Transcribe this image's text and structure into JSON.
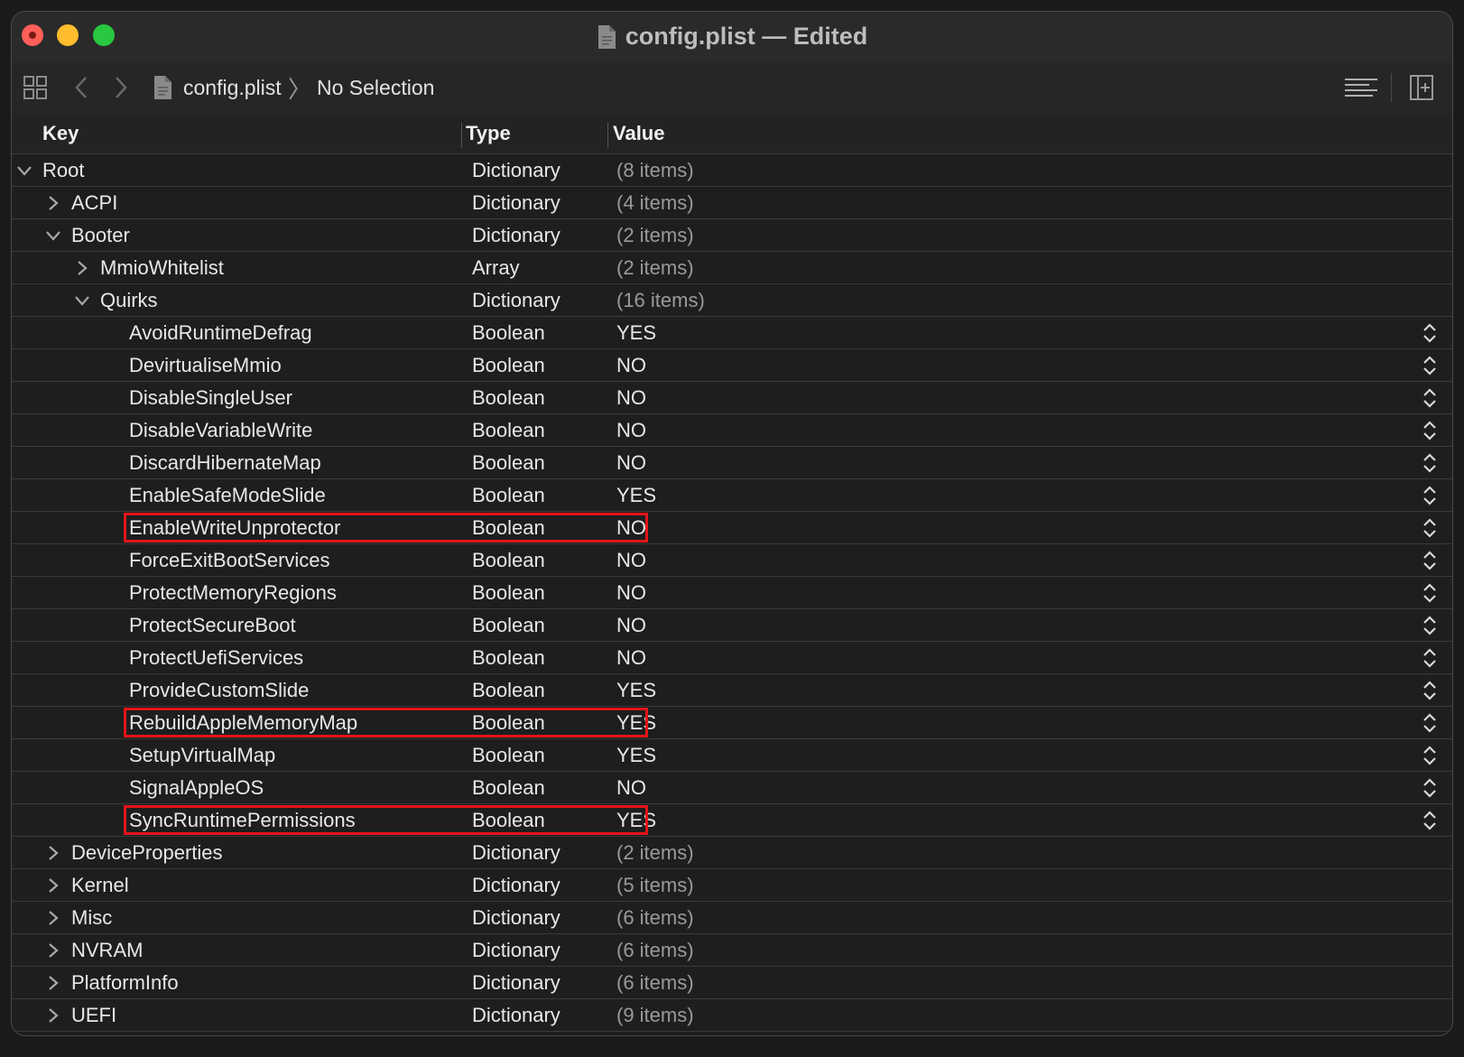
{
  "window": {
    "title": "config.plist — Edited"
  },
  "toolbar": {
    "grid_icon": "grid-icon",
    "back_icon": "chevron-left-icon",
    "forward_icon": "chevron-right-icon",
    "file_name": "config.plist",
    "separator": "〉",
    "selection": "No Selection",
    "editor_options_icon": "lines-icon",
    "add_editor_icon": "add-editor-icon"
  },
  "table": {
    "headers": {
      "key": "Key",
      "type": "Type",
      "value": "Value"
    },
    "rows": [
      {
        "key": "Root",
        "type": "Dictionary",
        "value": "(8 items)",
        "level": 0,
        "disclosure": "open",
        "kind": "container"
      },
      {
        "key": "ACPI",
        "type": "Dictionary",
        "value": "(4 items)",
        "level": 1,
        "disclosure": "closed",
        "kind": "container"
      },
      {
        "key": "Booter",
        "type": "Dictionary",
        "value": "(2 items)",
        "level": 1,
        "disclosure": "open",
        "kind": "container"
      },
      {
        "key": "MmioWhitelist",
        "type": "Array",
        "value": "(2 items)",
        "level": 2,
        "disclosure": "closed",
        "kind": "container"
      },
      {
        "key": "Quirks",
        "type": "Dictionary",
        "value": "(16 items)",
        "level": 2,
        "disclosure": "open",
        "kind": "container"
      },
      {
        "key": "AvoidRuntimeDefrag",
        "type": "Boolean",
        "value": "YES",
        "level": 3,
        "kind": "bool"
      },
      {
        "key": "DevirtualiseMmio",
        "type": "Boolean",
        "value": "NO",
        "level": 3,
        "kind": "bool"
      },
      {
        "key": "DisableSingleUser",
        "type": "Boolean",
        "value": "NO",
        "level": 3,
        "kind": "bool"
      },
      {
        "key": "DisableVariableWrite",
        "type": "Boolean",
        "value": "NO",
        "level": 3,
        "kind": "bool"
      },
      {
        "key": "DiscardHibernateMap",
        "type": "Boolean",
        "value": "NO",
        "level": 3,
        "kind": "bool"
      },
      {
        "key": "EnableSafeModeSlide",
        "type": "Boolean",
        "value": "YES",
        "level": 3,
        "kind": "bool"
      },
      {
        "key": "EnableWriteUnprotector",
        "type": "Boolean",
        "value": "NO",
        "level": 3,
        "kind": "bool",
        "highlighted": true
      },
      {
        "key": "ForceExitBootServices",
        "type": "Boolean",
        "value": "NO",
        "level": 3,
        "kind": "bool"
      },
      {
        "key": "ProtectMemoryRegions",
        "type": "Boolean",
        "value": "NO",
        "level": 3,
        "kind": "bool"
      },
      {
        "key": "ProtectSecureBoot",
        "type": "Boolean",
        "value": "NO",
        "level": 3,
        "kind": "bool"
      },
      {
        "key": "ProtectUefiServices",
        "type": "Boolean",
        "value": "NO",
        "level": 3,
        "kind": "bool"
      },
      {
        "key": "ProvideCustomSlide",
        "type": "Boolean",
        "value": "YES",
        "level": 3,
        "kind": "bool"
      },
      {
        "key": "RebuildAppleMemoryMap",
        "type": "Boolean",
        "value": "YES",
        "level": 3,
        "kind": "bool",
        "highlighted": true
      },
      {
        "key": "SetupVirtualMap",
        "type": "Boolean",
        "value": "YES",
        "level": 3,
        "kind": "bool"
      },
      {
        "key": "SignalAppleOS",
        "type": "Boolean",
        "value": "NO",
        "level": 3,
        "kind": "bool"
      },
      {
        "key": "SyncRuntimePermissions",
        "type": "Boolean",
        "value": "YES",
        "level": 3,
        "kind": "bool",
        "highlighted": true
      },
      {
        "key": "DeviceProperties",
        "type": "Dictionary",
        "value": "(2 items)",
        "level": 1,
        "disclosure": "closed",
        "kind": "container"
      },
      {
        "key": "Kernel",
        "type": "Dictionary",
        "value": "(5 items)",
        "level": 1,
        "disclosure": "closed",
        "kind": "container"
      },
      {
        "key": "Misc",
        "type": "Dictionary",
        "value": "(6 items)",
        "level": 1,
        "disclosure": "closed",
        "kind": "container"
      },
      {
        "key": "NVRAM",
        "type": "Dictionary",
        "value": "(6 items)",
        "level": 1,
        "disclosure": "closed",
        "kind": "container"
      },
      {
        "key": "PlatformInfo",
        "type": "Dictionary",
        "value": "(6 items)",
        "level": 1,
        "disclosure": "closed",
        "kind": "container"
      },
      {
        "key": "UEFI",
        "type": "Dictionary",
        "value": "(9 items)",
        "level": 1,
        "disclosure": "closed",
        "kind": "container"
      }
    ]
  },
  "colors": {
    "highlight": "#e21419",
    "muted_value": "#9a9a9a"
  }
}
